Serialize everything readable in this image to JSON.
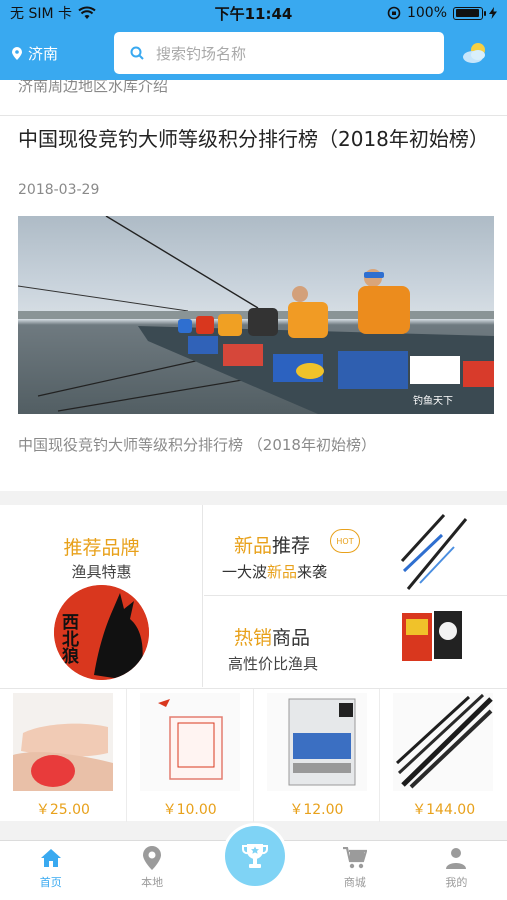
{
  "status_bar": {
    "carrier": "无 SIM 卡",
    "time": "下午11:44",
    "battery_percent": "100%",
    "battery_level": 1.0
  },
  "header": {
    "city": "济南",
    "search_placeholder": "搜索钓场名称",
    "weather_icon": "partly-cloudy-icon"
  },
  "previous_item": {
    "title": "济南周边地区水库介绍"
  },
  "article": {
    "title": "中国现役竞钓大师等级积分排行榜（2018年初始榜）",
    "date": "2018-03-29",
    "caption": "中国现役竞钓大师等级积分排行榜 （2018年初始榜）",
    "image_watermark": "钓鱼天下"
  },
  "shop": {
    "brand": {
      "title": "推荐品牌",
      "subtitle": "渔具特惠",
      "logo_text": "西北狼"
    },
    "new": {
      "title_highlight": "新品",
      "title_rest": "推荐",
      "badge": "HOT",
      "sub_pre": "一大波",
      "sub_highlight": "新品",
      "sub_post": "来袭"
    },
    "hot": {
      "title_highlight": "热销",
      "title_rest": "商品",
      "subtitle": "高性价比渔具"
    },
    "products": [
      {
        "price": "￥25.00"
      },
      {
        "price": "￥10.00"
      },
      {
        "price": "￥12.00"
      },
      {
        "price": "￥144.00"
      }
    ]
  },
  "tabbar": {
    "items": [
      {
        "label": "首页",
        "icon": "home-icon",
        "active": true
      },
      {
        "label": "本地",
        "icon": "location-pin-icon",
        "active": false
      },
      {
        "label": "",
        "icon": "trophy-icon",
        "active": false
      },
      {
        "label": "商城",
        "icon": "cart-icon",
        "active": false
      },
      {
        "label": "我的",
        "icon": "person-icon",
        "active": false
      }
    ]
  },
  "colors": {
    "primary_blue": "#39a9f0",
    "accent_orange": "#e8a11b",
    "fab_blue": "#7fd3f5"
  }
}
